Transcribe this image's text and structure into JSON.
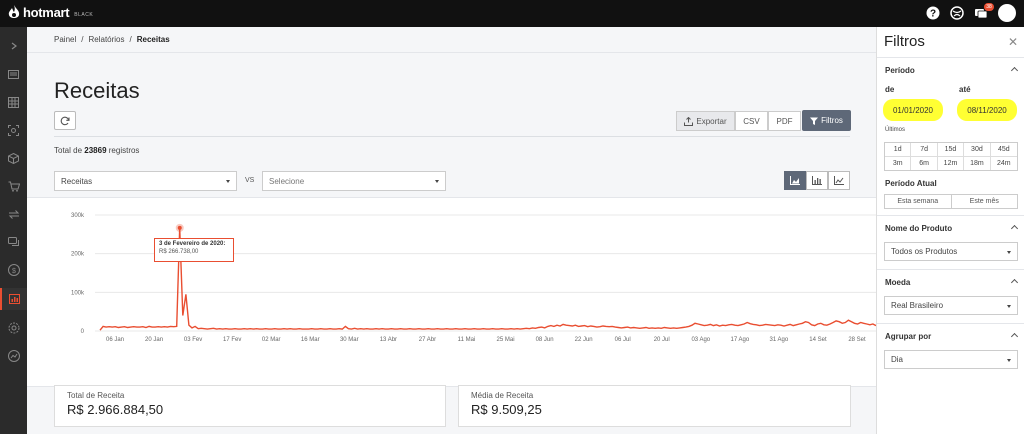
{
  "topbar": {
    "brand": "hotmart",
    "tier": "BLACK",
    "notification_count": "38"
  },
  "breadcrumb": {
    "items": [
      "Painel",
      "Relatórios",
      "Receitas"
    ],
    "separator": "/"
  },
  "page": {
    "title": "Receitas",
    "export_label": "Exportar",
    "csv_label": "CSV",
    "pdf_label": "PDF",
    "filters_label": "Filtros",
    "total_prefix": "Total de",
    "total_count": "23869",
    "total_suffix": "registros",
    "metric_select": "Receitas",
    "vs_label": "VS",
    "compare_placeholder": "Selecione"
  },
  "chart_data": {
    "type": "line",
    "y_ticks": [
      "300k",
      "200k",
      "100k",
      "0"
    ],
    "ylim": [
      0,
      300000
    ],
    "x_ticks": [
      "06 Jan",
      "20 Jan",
      "03 Fev",
      "17 Fev",
      "02 Mar",
      "16 Mar",
      "30 Mar",
      "13 Abr",
      "27 Abr",
      "11 Mai",
      "25 Mai",
      "08 Jun",
      "22 Jun",
      "06 Jul",
      "20 Jul",
      "03 Ago",
      "17 Ago",
      "31 Ago",
      "14 Set",
      "28 Set"
    ],
    "series": [
      {
        "color": "#e94e31",
        "values": [
          2000,
          12000,
          10000,
          11000,
          10000,
          11000,
          9000,
          10000,
          11000,
          9000,
          10000,
          11000,
          10000,
          10000,
          11000,
          9000,
          12000,
          10000,
          10000,
          11000,
          10000,
          11000,
          10000,
          12000,
          11000,
          12000,
          266738,
          40000,
          95000,
          15000,
          8000,
          12000,
          6000,
          7000,
          6000,
          5000,
          6000,
          7000,
          5000,
          6000,
          5000,
          6000,
          5000,
          5000,
          6000,
          5000,
          5000,
          6000,
          5000,
          6000,
          5000,
          6000,
          5000,
          5000,
          6000,
          5000,
          5000,
          6000,
          5000,
          5000,
          6000,
          5000,
          6000,
          5000,
          5000,
          6000,
          5000,
          5000,
          5000,
          6000,
          5000,
          5000,
          6000,
          5000,
          5000,
          6000,
          5000,
          5000,
          6000,
          5000,
          12000,
          6000,
          5000,
          7000,
          5000,
          6000,
          5000,
          6000,
          5000,
          5000,
          6000,
          5000,
          6000,
          5000,
          5000,
          6000,
          5000,
          5000,
          6000,
          5000,
          5000,
          6000,
          5000,
          5000,
          6000,
          5000,
          5000,
          6000,
          5000,
          5000,
          6000,
          5000,
          5000,
          6000,
          5000,
          5000,
          6000,
          5000,
          5000,
          6000,
          5000,
          5000,
          6000,
          5000,
          5000,
          6000,
          5000,
          5000,
          6000,
          5000,
          5000,
          6000,
          5000,
          5000,
          6000,
          5000,
          6000,
          5000,
          6000,
          7000,
          6000,
          8000,
          7000,
          9000,
          10000,
          8000,
          12000,
          14000,
          12000,
          15000,
          13000,
          17000,
          15000,
          14000,
          13000,
          15000,
          12000,
          13000,
          14000,
          11000,
          13000,
          12000,
          10000,
          11000,
          13000,
          12000,
          11000,
          12000,
          10000,
          9000,
          8000,
          9000,
          10000,
          8000,
          9000,
          8000,
          7000,
          8000,
          9000,
          7000,
          8000,
          7000,
          8000,
          7000,
          9000,
          8000,
          7000,
          8000,
          7000,
          8000,
          9000,
          10000,
          12000,
          15000,
          20000,
          18000,
          16000,
          14000,
          15000,
          17000,
          14000,
          16000,
          13000,
          15000,
          14000,
          16000,
          17000,
          15000,
          14000,
          16000,
          18000,
          22000,
          19000,
          17000,
          16000,
          14000,
          15000,
          17000,
          16000,
          15000,
          14000,
          16000,
          15000,
          13000,
          15000,
          17000,
          14000,
          16000,
          18000,
          20000,
          24000,
          22000,
          16000,
          14000,
          18000,
          20000,
          16000,
          15000,
          18000,
          22000,
          26000,
          24000,
          20000,
          22000,
          28000,
          24000,
          20000,
          18000,
          22000,
          20000,
          18000,
          16000,
          18000,
          14000
        ]
      }
    ],
    "tooltip": {
      "date": "3 de Fevereiro de 2020:",
      "value": "R$ 266.738,00"
    }
  },
  "cards": {
    "total_label": "Total de Receita",
    "total_value": "R$ 2.966.884,50",
    "avg_label": "Média de Receita",
    "avg_value": "R$ 9.509,25"
  },
  "filters": {
    "title": "Filtros",
    "close": "✕",
    "period_section": "Período",
    "from_label": "de",
    "to_label": "até",
    "from_date": "01/01/2020",
    "to_date": "08/11/2020",
    "last_label": "Últimos",
    "ranges": [
      "1d",
      "7d",
      "15d",
      "30d",
      "45d",
      "3m",
      "6m",
      "12m",
      "18m",
      "24m"
    ],
    "current_period_label": "Período Atual",
    "this_week": "Esta semana",
    "this_month": "Este mês",
    "product_section": "Nome do Produto",
    "product_value": "Todos os Produtos",
    "currency_section": "Moeda",
    "currency_value": "Real Brasileiro",
    "group_section": "Agrupar por",
    "group_value": "Dia"
  }
}
